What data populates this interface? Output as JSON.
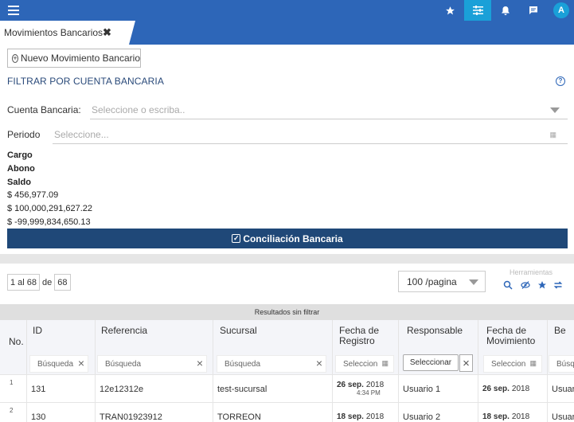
{
  "topbar": {
    "icons": [
      "star-icon",
      "sliders-icon",
      "bell-icon",
      "chat-icon"
    ],
    "avatar_letter": "A",
    "colors": {
      "bar": "#2d66b8",
      "active": "#1aa0d8"
    }
  },
  "tab": {
    "label": "Movimientos Bancarios",
    "close": "✖"
  },
  "toolbar": {
    "new_label": "Nuevo Movimiento Bancario"
  },
  "filter": {
    "title": "FILTRAR POR CUENTA BANCARIA",
    "help": "?",
    "account_label": "Cuenta Bancaria:",
    "account_placeholder": "Seleccione o escriba..",
    "period_label": "Periodo",
    "period_placeholder": "Seleccione..."
  },
  "totals": {
    "cargo_label": "Cargo",
    "abono_label": "Abono",
    "saldo_label": "Saldo",
    "value1": "$ 456,977.09",
    "value2": "$ 100,000,291,627.22",
    "value3": "$ -99,999,834,650.13"
  },
  "conciliacion": {
    "label": "Conciliación Bancaria"
  },
  "pager": {
    "range": "1 al 68",
    "de": "de",
    "total": "68",
    "per_page": "100 /pagina"
  },
  "tools": {
    "label": "Herramientas"
  },
  "results": {
    "label": "Resultados sin filtrar"
  },
  "table": {
    "no_label": "No.",
    "columns": {
      "id": "ID",
      "referencia": "Referencia",
      "sucursal": "Sucursal",
      "fecha_registro_1": "Fecha de",
      "fecha_registro_2": "Registro",
      "responsable": "Responsable",
      "fecha_movimiento_1": "Fecha de",
      "fecha_movimiento_2": "Movimiento",
      "beneficiario": "Be"
    },
    "search_placeholder": "Búsqueda",
    "date_placeholder": "Seleccion",
    "select_label": "Seleccionar",
    "clear_symbol": "×",
    "rows": [
      {
        "no": "1",
        "id": "131",
        "referencia": "12e12312e",
        "sucursal": "test-sucursal",
        "fecha_registro_day": "26 sep.",
        "fecha_registro_year": "2018",
        "fecha_registro_time": "4:34 PM",
        "responsable": "Usuario 1",
        "fecha_mov_day": "26 sep.",
        "fecha_mov_year": "2018",
        "beneficiario": "Usuar"
      },
      {
        "no": "2",
        "id": "130",
        "referencia": "TRAN01923912",
        "sucursal": "TORREON",
        "fecha_registro_day": "18 sep.",
        "fecha_registro_year": "2018",
        "fecha_registro_time": "",
        "responsable": "Usuario 2",
        "fecha_mov_day": "18 sep.",
        "fecha_mov_year": "2018",
        "beneficiario": "Usuar"
      }
    ]
  }
}
